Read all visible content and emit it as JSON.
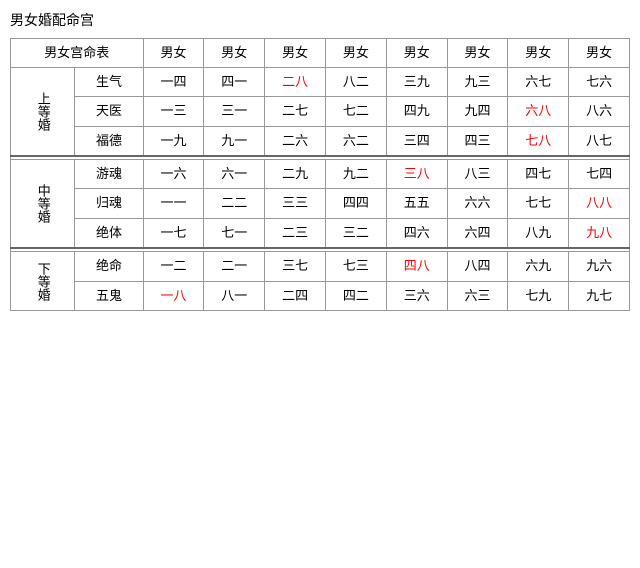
{
  "title": "男女婚配命宫",
  "table": {
    "header": {
      "col0": "男女宫命表",
      "cols": [
        "男女",
        "男女",
        "男女",
        "男女",
        "男女",
        "男女",
        "男女",
        "男女"
      ]
    },
    "groups": [
      {
        "group_label": "上等婚",
        "rows": [
          {
            "sub_label": "生气",
            "cells": [
              {
                "text": "一四",
                "red": false
              },
              {
                "text": "四一",
                "red": false
              },
              {
                "text": "二八",
                "red": true
              },
              {
                "text": "八二",
                "red": false
              },
              {
                "text": "三九",
                "red": false
              },
              {
                "text": "九三",
                "red": false
              },
              {
                "text": "六七",
                "red": false
              },
              {
                "text": "七六",
                "red": false
              }
            ]
          },
          {
            "sub_label": "天医",
            "cells": [
              {
                "text": "一三",
                "red": false
              },
              {
                "text": "三一",
                "red": false
              },
              {
                "text": "二七",
                "red": false
              },
              {
                "text": "七二",
                "red": false
              },
              {
                "text": "四九",
                "red": false
              },
              {
                "text": "九四",
                "red": false
              },
              {
                "text": "六八",
                "red": true
              },
              {
                "text": "八六",
                "red": false
              }
            ]
          },
          {
            "sub_label": "福德",
            "cells": [
              {
                "text": "一九",
                "red": false
              },
              {
                "text": "九一",
                "red": false
              },
              {
                "text": "二六",
                "red": false
              },
              {
                "text": "六二",
                "red": false
              },
              {
                "text": "三四",
                "red": false
              },
              {
                "text": "四三",
                "red": false
              },
              {
                "text": "七八",
                "red": true
              },
              {
                "text": "八七",
                "red": false
              }
            ]
          }
        ]
      },
      {
        "group_label": "中等婚",
        "rows": [
          {
            "sub_label": "游魂",
            "cells": [
              {
                "text": "一六",
                "red": false
              },
              {
                "text": "六一",
                "red": false
              },
              {
                "text": "二九",
                "red": false
              },
              {
                "text": "九二",
                "red": false
              },
              {
                "text": "三八",
                "red": true
              },
              {
                "text": "八三",
                "red": false
              },
              {
                "text": "四七",
                "red": false
              },
              {
                "text": "七四",
                "red": false
              }
            ]
          },
          {
            "sub_label": "归魂",
            "cells": [
              {
                "text": "一一",
                "red": false
              },
              {
                "text": "二二",
                "red": false
              },
              {
                "text": "三三",
                "red": false
              },
              {
                "text": "四四",
                "red": false
              },
              {
                "text": "五五",
                "red": false
              },
              {
                "text": "六六",
                "red": false
              },
              {
                "text": "七七",
                "red": false
              },
              {
                "text": "八八",
                "red": true
              }
            ]
          },
          {
            "sub_label": "绝体",
            "cells": [
              {
                "text": "一七",
                "red": false
              },
              {
                "text": "七一",
                "red": false
              },
              {
                "text": "二三",
                "red": false
              },
              {
                "text": "三二",
                "red": false
              },
              {
                "text": "四六",
                "red": false
              },
              {
                "text": "六四",
                "red": false
              },
              {
                "text": "八九",
                "red": false
              },
              {
                "text": "九八",
                "red": true
              }
            ]
          }
        ]
      },
      {
        "group_label": "下等婚",
        "rows": [
          {
            "sub_label": "绝命",
            "cells": [
              {
                "text": "一二",
                "red": false
              },
              {
                "text": "二一",
                "red": false
              },
              {
                "text": "三七",
                "red": false
              },
              {
                "text": "七三",
                "red": false
              },
              {
                "text": "四八",
                "red": true
              },
              {
                "text": "八四",
                "red": false
              },
              {
                "text": "六九",
                "red": false
              },
              {
                "text": "九六",
                "red": false
              }
            ]
          },
          {
            "sub_label": "五鬼",
            "cells": [
              {
                "text": "一八",
                "red": true
              },
              {
                "text": "八一",
                "red": false
              },
              {
                "text": "二四",
                "red": false
              },
              {
                "text": "四二",
                "red": false
              },
              {
                "text": "三六",
                "red": false
              },
              {
                "text": "六三",
                "red": false
              },
              {
                "text": "七九",
                "red": false
              },
              {
                "text": "九七",
                "red": false
              }
            ]
          }
        ]
      }
    ]
  }
}
